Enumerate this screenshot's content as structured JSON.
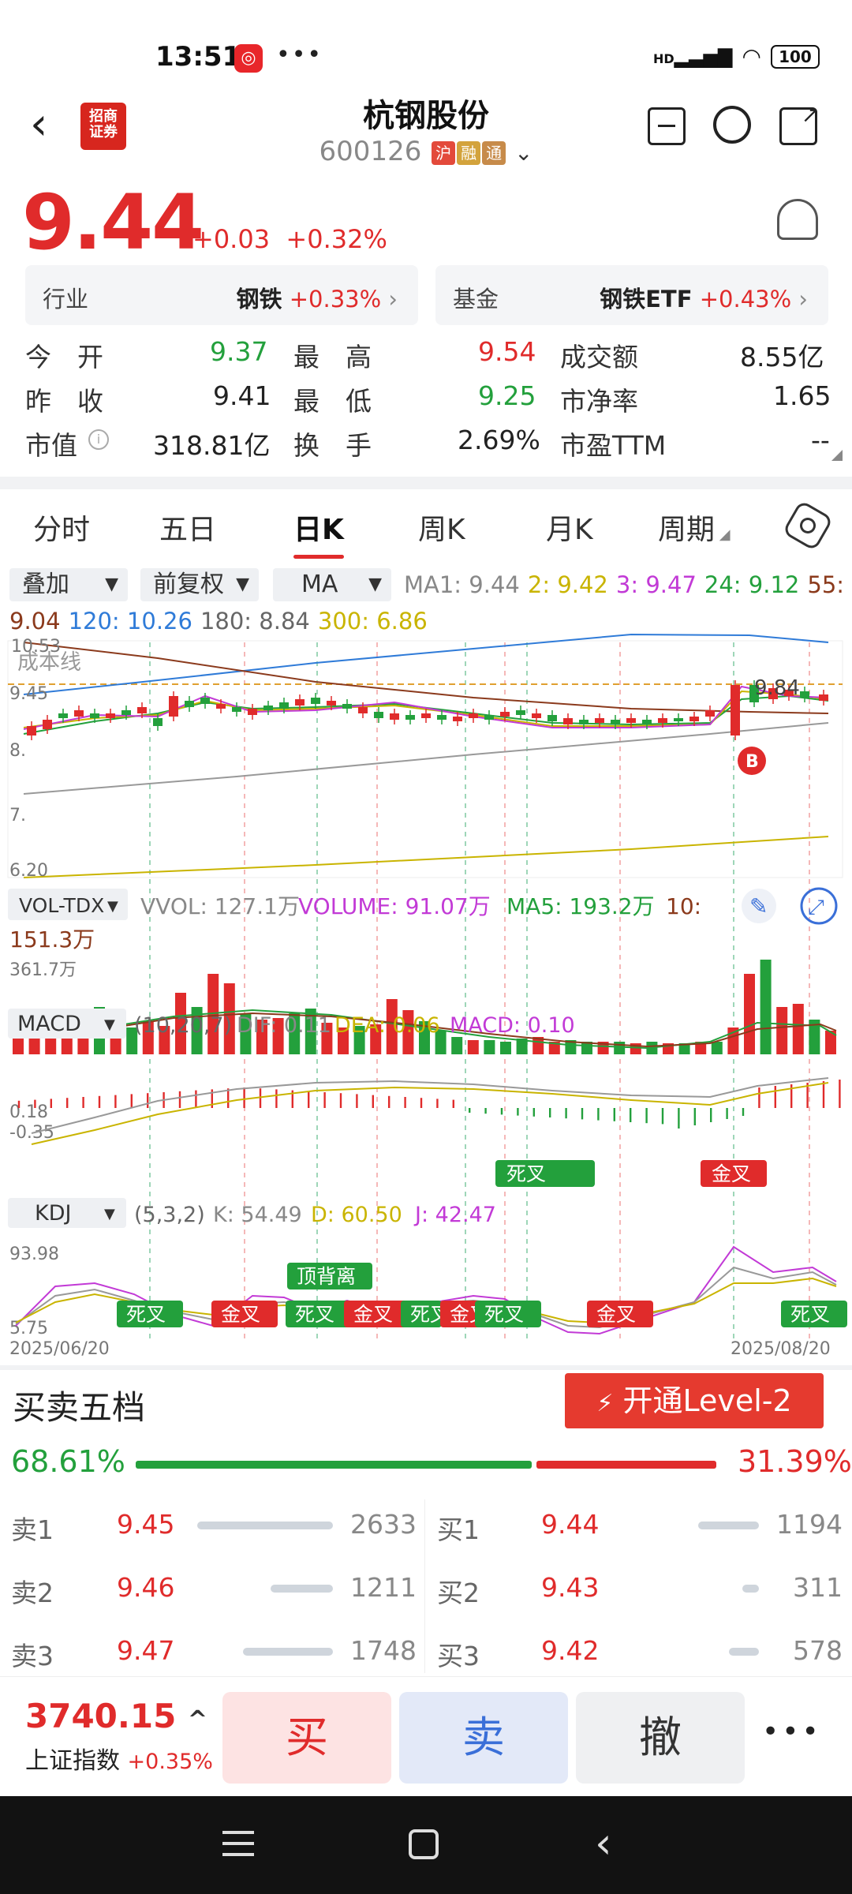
{
  "status_bar": {
    "time": "13:51",
    "battery": "100",
    "network": "HD"
  },
  "header": {
    "title": "杭钢股份",
    "code": "600126",
    "tags": [
      "沪",
      "融",
      "通"
    ],
    "logo_text": "招商证券"
  },
  "quote": {
    "price": "9.44",
    "change": "+0.03",
    "change_pct": "+0.32%"
  },
  "pills": [
    {
      "label": "行业",
      "name": "钢铁",
      "pct": "+0.33%"
    },
    {
      "label": "基金",
      "name": "钢铁ETF",
      "pct": "+0.43%"
    }
  ],
  "stats": [
    [
      {
        "label": "今　开",
        "value": "9.37"
      },
      {
        "label": "最　高",
        "value": "9.54"
      },
      {
        "label": "成交额",
        "value": "8.55亿"
      }
    ],
    [
      {
        "label": "昨　收",
        "value": "9.41"
      },
      {
        "label": "最　低",
        "value": "9.25"
      },
      {
        "label": "市净率",
        "value": "1.65"
      }
    ],
    [
      {
        "label": "市值",
        "value": "318.81亿"
      },
      {
        "label": "换　手",
        "value": "2.69%"
      },
      {
        "label": "市盈TTM",
        "value": "--"
      }
    ]
  ],
  "tabs": [
    "分时",
    "五日",
    "日K",
    "周K",
    "月K",
    "周期"
  ],
  "active_tab": "日K",
  "chart_toolbar": {
    "overlay": "叠加",
    "adjust": "前复权",
    "ma": "MA",
    "ma_values": [
      {
        "text": "MA1: 9.44",
        "color": "#888888"
      },
      {
        "text": "2: 9.42",
        "color": "#c9b400"
      },
      {
        "text": "3: 9.47",
        "color": "#c23ad6"
      },
      {
        "text": "24: 9.12",
        "color": "#23a03c"
      },
      {
        "text": "55:",
        "color": "#8b3a1c"
      }
    ],
    "ma_values2": [
      {
        "text": "9.04",
        "color": "#8b3a1c"
      },
      {
        "text": "120: 10.26",
        "color": "#2f7bd8"
      },
      {
        "text": "180: 8.84",
        "color": "#666666"
      },
      {
        "text": "300: 6.86",
        "color": "#c9b400"
      }
    ]
  },
  "kline": {
    "y_labels": [
      "10.53",
      "9.45",
      "8.",
      "7.",
      "6.20"
    ],
    "cost_line_label": "成本线",
    "marker_price": "9.84",
    "buy_marker": "B"
  },
  "volume": {
    "selector": "VOL-TDX",
    "vvol": "VVOL: 127.1万",
    "volume": "VOLUME: 91.07万",
    "ma5": "MA5: 193.2万",
    "ma10_label": "10:",
    "ma10_value": "151.3万",
    "max_label": "361.7万"
  },
  "macd": {
    "selector": "MACD",
    "params": "(10,20,7)",
    "dif": "DIF: 0.11",
    "dea": "DEA: 0.06",
    "macd": "MACD: 0.10",
    "top_label": "0.18",
    "bottom_label": "-0.35",
    "signals": [
      "死叉",
      "金叉"
    ]
  },
  "kdj": {
    "selector": "KDJ",
    "params": "(5,3,2)",
    "k": "K: 54.49",
    "d": "D: 60.50",
    "j": "J: 42.47",
    "top_label": "93.98",
    "bottom_label": "5.75",
    "top_signal": "顶背离",
    "signals": [
      "死叉",
      "金叉",
      "死叉",
      "金叉",
      "死叉",
      "金叉",
      "死叉",
      "金叉",
      "死叉"
    ],
    "date_start": "2025/06/20",
    "date_end": "2025/08/20"
  },
  "order_book": {
    "title": "买卖五档",
    "level2_btn": "开通Level-2",
    "sell_pct": "68.61%",
    "buy_pct": "31.39%",
    "sells": [
      {
        "label": "卖1",
        "price": "9.45",
        "vol": "2633",
        "frac": 1.0
      },
      {
        "label": "卖2",
        "price": "9.46",
        "vol": "1211",
        "frac": 0.46
      },
      {
        "label": "卖3",
        "price": "9.47",
        "vol": "1748",
        "frac": 0.66
      }
    ],
    "buys": [
      {
        "label": "买1",
        "price": "9.44",
        "vol": "1194",
        "frac": 0.45
      },
      {
        "label": "买2",
        "price": "9.43",
        "vol": "311",
        "frac": 0.12
      },
      {
        "label": "买3",
        "price": "9.42",
        "vol": "578",
        "frac": 0.22
      }
    ]
  },
  "bottom_bar": {
    "index_value": "3740.15",
    "index_name": "上证指数",
    "index_pct": "+0.35%",
    "buy": "买",
    "sell": "卖",
    "cancel": "撤",
    "more": "•••"
  }
}
